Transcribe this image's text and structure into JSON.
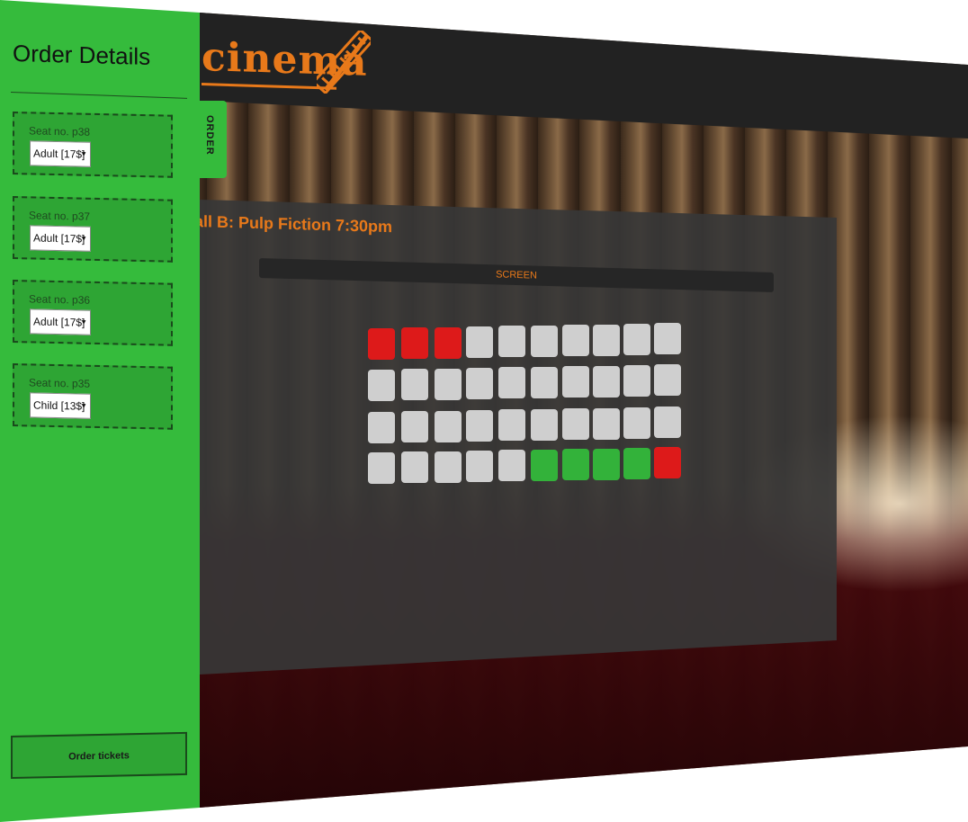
{
  "header": {
    "logo_text": "cinema"
  },
  "order_panel": {
    "title": "Order Details",
    "tab_label": "ORDER",
    "items": [
      {
        "seat_label": "Seat no. p38",
        "ticket_type": "Adult [17$]"
      },
      {
        "seat_label": "Seat no. p37",
        "ticket_type": "Adult [17$]"
      },
      {
        "seat_label": "Seat no. p36",
        "ticket_type": "Adult [17$]"
      },
      {
        "seat_label": "Seat no. p35",
        "ticket_type": "Child [13$]"
      }
    ],
    "order_button": "Order tickets"
  },
  "hall": {
    "title": "all B: Pulp Fiction 7:30pm",
    "screen_label": "SCREEN",
    "rows": [
      [
        "taken",
        "taken",
        "taken",
        "free",
        "free",
        "free",
        "free",
        "free",
        "free",
        "free"
      ],
      [
        "free",
        "free",
        "free",
        "free",
        "free",
        "free",
        "free",
        "free",
        "free",
        "free"
      ],
      [
        "free",
        "free",
        "free",
        "free",
        "free",
        "free",
        "free",
        "free",
        "free",
        "free"
      ],
      [
        "free",
        "free",
        "free",
        "free",
        "free",
        "selected",
        "selected",
        "selected",
        "selected",
        "taken"
      ]
    ]
  },
  "colors": {
    "accent": "#e8791a",
    "panel_green": "#35bb3c",
    "taken": "#dd1a1a",
    "free": "#cfcfcf",
    "selected": "#33b23a"
  }
}
